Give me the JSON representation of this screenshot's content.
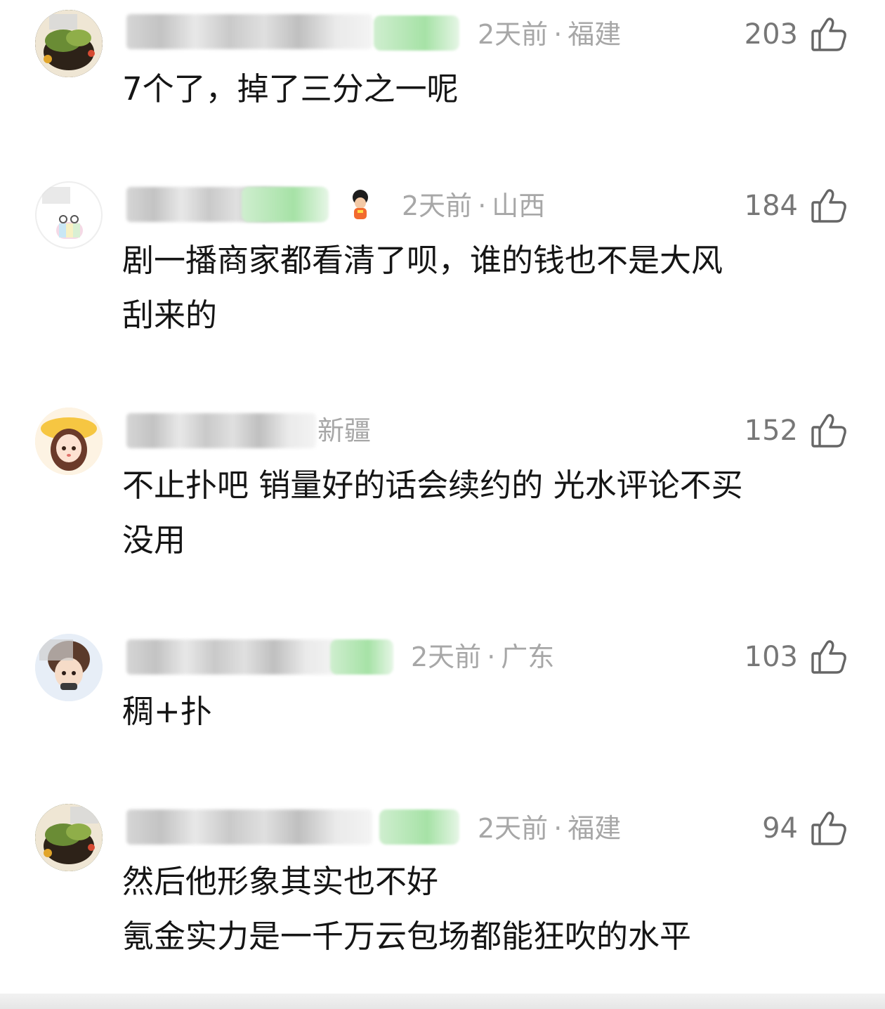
{
  "comments": [
    {
      "time": "2天前",
      "location": "福建",
      "likes": "203",
      "text_lines": [
        "7个了，掉了三分之一呢"
      ]
    },
    {
      "time": "2天前",
      "location": "山西",
      "likes": "184",
      "text_lines": [
        "剧一播商家都看清了呗，谁的钱也不是大风",
        "刮来的"
      ]
    },
    {
      "time": "",
      "location": "新疆",
      "likes": "152",
      "text_lines": [
        "不止扑吧 销量好的话会续约的 光水评论不买",
        "没用"
      ]
    },
    {
      "time": "2天前",
      "location": "广东",
      "likes": "103",
      "text_lines": [
        "稠+扑"
      ]
    },
    {
      "time": "2天前",
      "location": "福建",
      "likes": "94",
      "text_lines": [
        "然后他形象其实也不好",
        "氪金实力是一千万云包场都能狂吹的水平"
      ]
    }
  ],
  "icons": {
    "like": "thumbs-up-icon",
    "avatar": "avatar"
  },
  "colors": {
    "meta_text": "#a7a7a7",
    "likes_text": "#777777",
    "body_text": "#151515"
  }
}
